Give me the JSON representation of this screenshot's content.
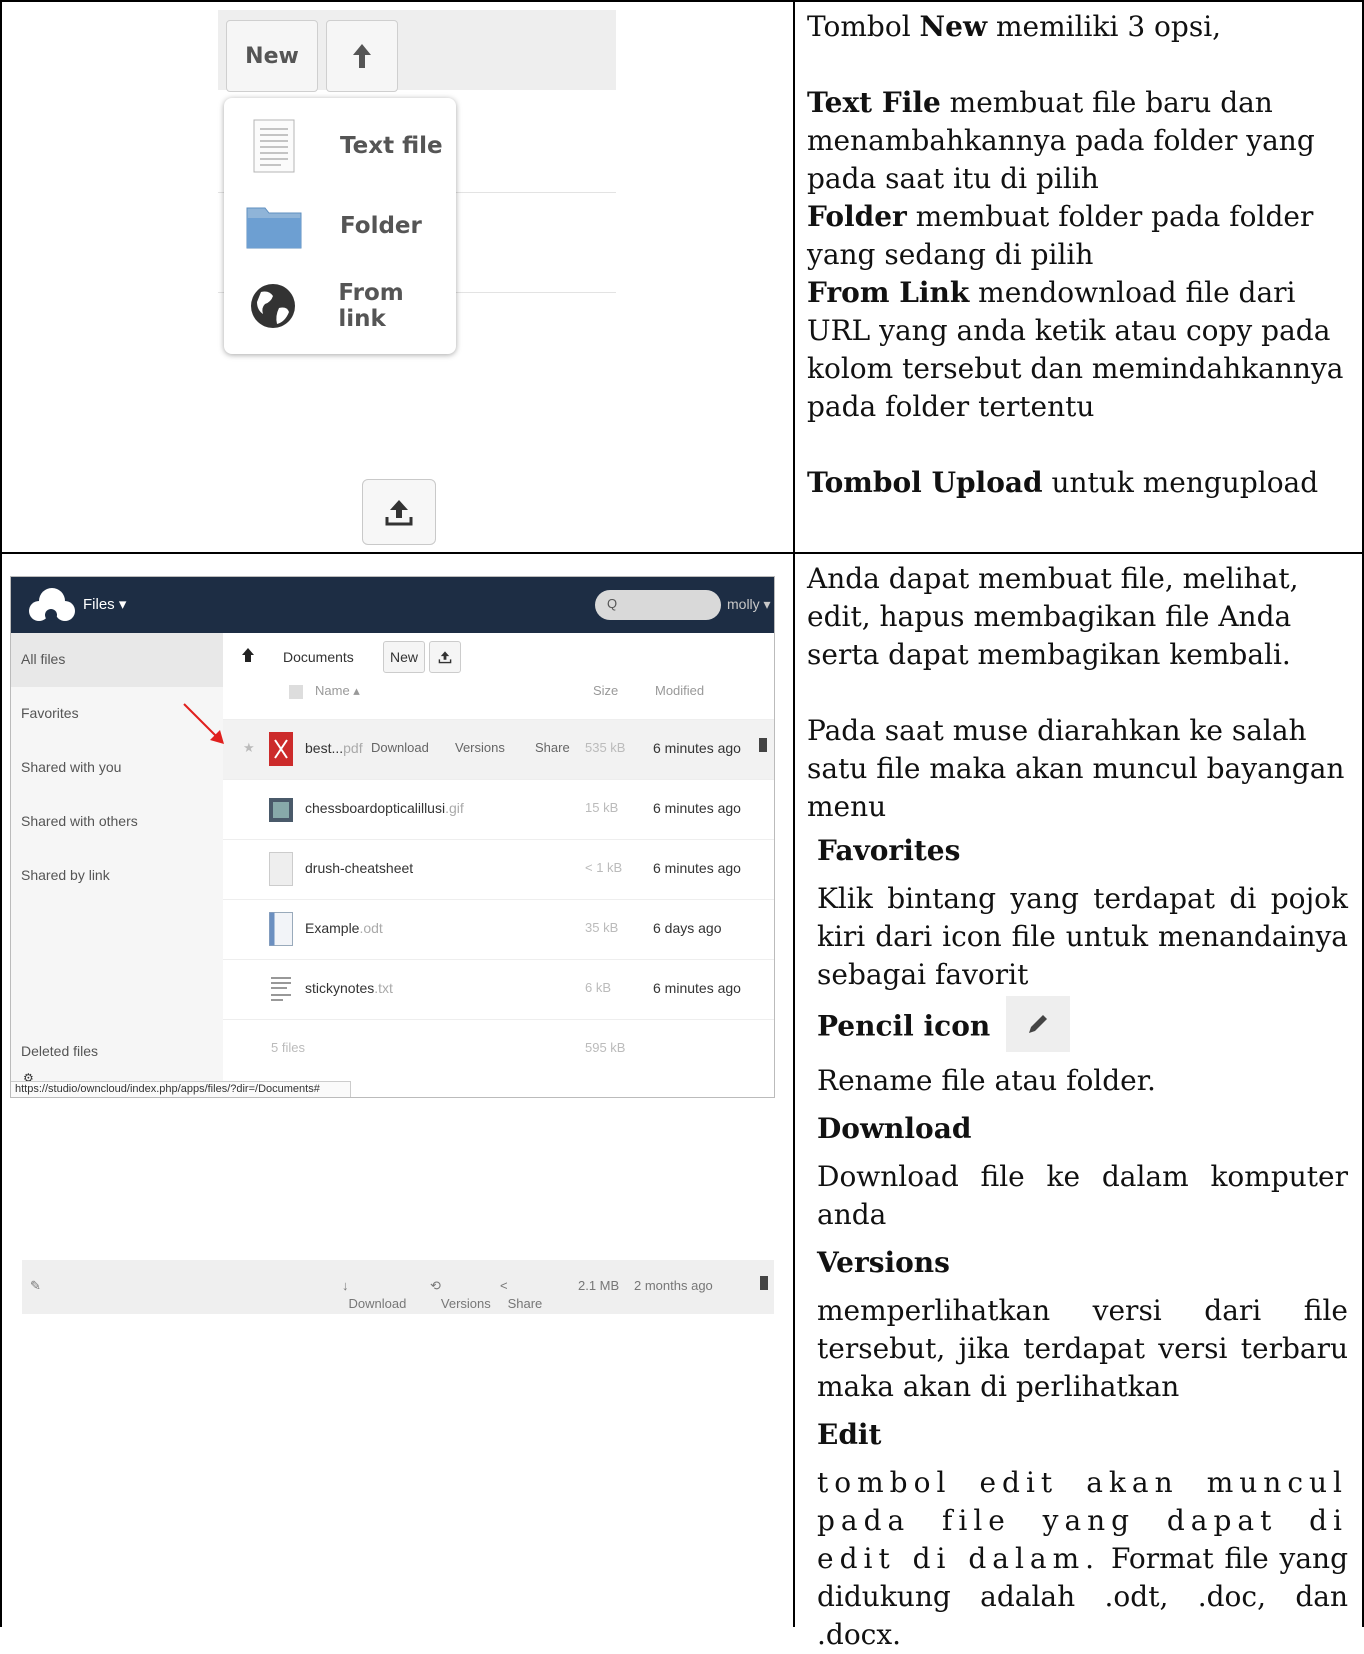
{
  "row1": {
    "screenshot": {
      "new_button": "New",
      "menu_items": [
        {
          "label": "Text file",
          "icon": "text-file-icon"
        },
        {
          "label": "Folder",
          "icon": "folder-icon"
        },
        {
          "label": "From link",
          "icon": "globe-icon"
        }
      ]
    },
    "text": {
      "intro_prefix": "Tombol ",
      "intro_bold": "New",
      "intro_suffix": " memiliki 3 opsi,",
      "textfile_bold": "Text File",
      "textfile_desc": " membuat file baru dan menambahkannya pada folder yang pada saat itu di pilih",
      "folder_bold": "Folder",
      "folder_desc": " membuat folder pada folder yang sedang di pilih",
      "fromlink_bold": "From Link",
      "fromlink_desc": " mendownload file dari URL yang anda ketik atau copy pada kolom tersebut dan memindahkannya pada folder tertentu",
      "upload_bold": "Tombol Upload",
      "upload_desc": " untuk mengupload"
    }
  },
  "row2": {
    "owncloud": {
      "app_title": "Files ▾",
      "search_icon": "Q",
      "user": "molly ▾",
      "sidebar": [
        "All files",
        "Favorites",
        "Shared with you",
        "Shared with others",
        "Shared by link"
      ],
      "deleted": "Deleted files",
      "breadcrumb": "Documents",
      "new_button": "New",
      "header_name": "Name ▴",
      "header_size": "Size",
      "header_modified": "Modified",
      "files": [
        {
          "name": "best...",
          "ext": "pdf",
          "size": "535 kB",
          "modified": "6 minutes ago"
        },
        {
          "name": "chessboardopticalillusi",
          "ext": ".gif",
          "size": "15 kB",
          "modified": "6 minutes ago"
        },
        {
          "name": "drush-cheatsheet",
          "ext": "",
          "size": "< 1 kB",
          "modified": "6 minutes ago"
        },
        {
          "name": "Example",
          "ext": ".odt",
          "size": "35 kB",
          "modified": "6 days ago"
        },
        {
          "name": "stickynotes",
          "ext": ".txt",
          "size": "6 kB",
          "modified": "6 minutes ago"
        }
      ],
      "hover_actions": {
        "download": "Download",
        "versions": "Versions",
        "share": "Share"
      },
      "summary_files": "5 files",
      "summary_size": "595 kB",
      "status_url": "https://studio/owncloud/index.php/apps/files/?dir=/Documents#"
    },
    "strip": {
      "download": "Download",
      "versions": "Versions",
      "share": "Share",
      "size": "2.1 MB",
      "modified": "2 months ago"
    },
    "text": {
      "p1": "Anda dapat membuat file, melihat, edit, hapus membagikan file Anda serta dapat membagikan kembali.",
      "p2": "Pada saat muse diarahkan ke salah satu file maka akan muncul bayangan menu",
      "h_fav": "Favorites",
      "d_fav": "Klik bintang yang terdapat di pojok kiri dari icon file untuk menandainya sebagai favorit",
      "h_pencil": "Pencil icon",
      "d_pencil": "Rename file atau folder.",
      "h_download": "Download",
      "d_download": "Download file ke dalam komputer anda",
      "h_versions": "Versions",
      "d_versions": "memperlihatkan versi dari file tersebut, jika terdapat versi terbaru maka akan di perlihatkan",
      "h_edit": "Edit",
      "d_edit_spaced": "tombol edit akan muncul pada file yang dapat di edit di dalam.",
      "d_edit_rest": " Format file yang didukung adalah .odt, .doc, dan .docx."
    }
  },
  "colors": {
    "owncloud_header": "#1d2d44",
    "arrow": "#e0201e",
    "pdf_red": "#cc2b2b"
  }
}
